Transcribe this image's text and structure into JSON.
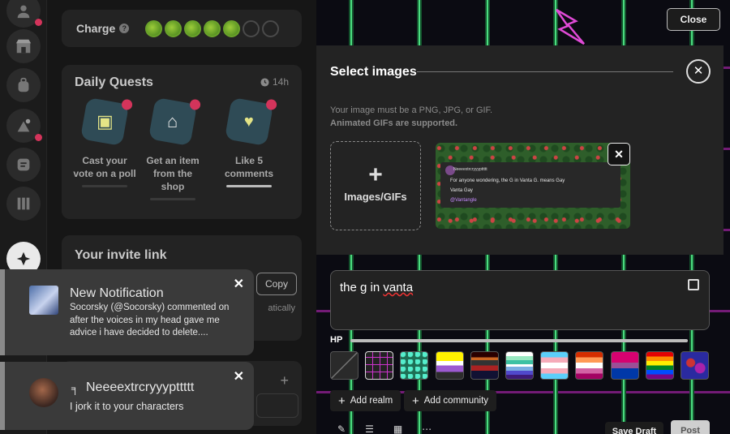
{
  "sidebar": {
    "icons": [
      "user-icon",
      "store-icon",
      "backpack-icon",
      "quest-icon",
      "dice-icon",
      "library-icon",
      "logo-icon"
    ]
  },
  "charge": {
    "label": "Charge",
    "help": "?",
    "filled": 5,
    "total": 7
  },
  "daily_quests": {
    "title": "Daily Quests",
    "time": "14h",
    "items": [
      {
        "label": "Cast your vote on a poll"
      },
      {
        "label": "Get an item from the shop"
      },
      {
        "label": "Like 5 comments"
      }
    ]
  },
  "invite": {
    "title": "Your invite link",
    "copy_label": "Copy",
    "partial_text": "atically"
  },
  "notifications": [
    {
      "title": "New Notification",
      "body": "Socorsky (@Socorsky) commented on after the voices in my head gave me advice i have decided to delete...."
    },
    {
      "title": "Neeeextrcryyypttttt",
      "body": "I jork it to your characters"
    }
  ],
  "modal": {
    "close_top": "Close",
    "title": "Select images",
    "hint_line1": "Your image must be a PNG, JPG, or GIF.",
    "hint_line2": "Animated GIFs are supported.",
    "add_label": "Images/GIFs",
    "thumb": {
      "author": "Neeeextrcryyypttttt",
      "line1": "For anyone wondering, the G in Vanta G. means Gay",
      "line2": "Vanta Gay",
      "line3": "@Vantangle"
    }
  },
  "composer": {
    "text_prefix": "the g in ",
    "text_underlined": "vanta",
    "hp_label": "HP",
    "add_realm": "Add realm",
    "add_community": "Add community",
    "save_draft": "Save Draft",
    "post": "Post",
    "themes": [
      "none",
      "grid",
      "scales",
      "nonbinary",
      "glitch",
      "lesbian",
      "trans",
      "lesbian-alt",
      "bi",
      "rainbow",
      "blob"
    ]
  },
  "colors": {
    "accent_neon_green": "#4ade80",
    "alert_red": "#d4345b"
  }
}
